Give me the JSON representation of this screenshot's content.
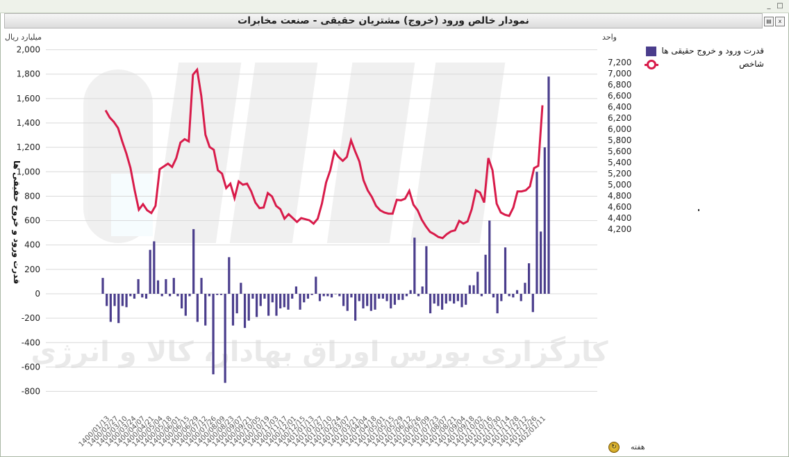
{
  "window": {
    "title": "نمودار خالص ورود (خروج) مشتریان حقیقی - صنعت مخابرات",
    "minimize_glyph": "_",
    "maximize_glyph": "□"
  },
  "toolbar": {
    "print_icon": "printer-icon",
    "export_icon": "excel-icon"
  },
  "footer": {
    "x_axis_unit": "هفته",
    "refresh_icon": "refresh-icon"
  },
  "watermark": "کارگزاری بورس اوراق بهادار، کالا و انرژی",
  "colors": {
    "bars": "#4a3d8c",
    "line": "#d81b4a",
    "grid": "#d9d9d9"
  },
  "chart_data": {
    "type": "bar+line",
    "left_axis_unit": "میلیارد ریال",
    "left_axis_title": "قدرت ورود و خروج حقیقی ها",
    "right_axis_unit": "واحد",
    "left_ylim": [
      -900,
      2000
    ],
    "right_ylim": [
      4100,
      7300
    ],
    "left_ticks": [
      "2,000",
      "1,800",
      "1,600",
      "1,400",
      "1,200",
      "1,000",
      "800",
      "600",
      "400",
      "200",
      "0",
      "-200",
      "-400",
      "-600",
      "-800"
    ],
    "left_tick_values": [
      2000,
      1800,
      1600,
      1400,
      1200,
      1000,
      800,
      600,
      400,
      200,
      0,
      -200,
      -400,
      -600,
      -800
    ],
    "right_ticks": [
      "7,200",
      "7,000",
      "6,800",
      "6,600",
      "6,400",
      "6,200",
      "6,000",
      "5,800",
      "5,600",
      "5,400",
      "5,200",
      "5,000",
      "4,800",
      "4,600",
      "4,400",
      "4,200"
    ],
    "right_tick_values": [
      7200,
      7000,
      6800,
      6600,
      6400,
      6200,
      6000,
      5800,
      5600,
      5400,
      5200,
      5000,
      4800,
      4600,
      4400,
      4200
    ],
    "x_tick_labels": [
      "1400/01/13",
      "1400/02/27",
      "1400/03/10",
      "1400/03/24",
      "1400/04/07",
      "1400/04/21",
      "1400/05/04",
      "1400/05/18",
      "1400/06/01",
      "1400/06/15",
      "1400/06/29",
      "1400/07/12",
      "1400/07/26",
      "1400/08/09",
      "1400/08/23",
      "1400/09/07",
      "1400/09/21",
      "1400/10/05",
      "1400/10/19",
      "1400/11/03",
      "1400/11/17",
      "1400/12/01",
      "1400/12/15",
      "1401/01/13",
      "1401/01/27",
      "1401/02/10",
      "1401/02/24",
      "1401/03/07",
      "1401/03/21",
      "1401/04/04",
      "1401/04/18",
      "1401/05/01",
      "1401/05/15",
      "1401/05/29",
      "1401/06/12",
      "1401/06/26",
      "1401/07/09",
      "1401/07/23",
      "1401/08/07",
      "1401/08/21",
      "1401/09/04",
      "1401/09/18",
      "1401/10/02",
      "1401/10/16",
      "1401/10/30",
      "1401/11/14",
      "1401/11/28",
      "1401/12/12",
      "1401/12/26",
      "1402/01/11"
    ],
    "series": [
      {
        "name": "قدرت ورود و خروج حقیقی ها",
        "type": "bar",
        "axis": "left",
        "values": [
          130,
          -100,
          -230,
          -100,
          -240,
          -100,
          -110,
          -20,
          -40,
          120,
          -30,
          -40,
          360,
          430,
          110,
          -20,
          120,
          -20,
          130,
          -20,
          -120,
          -180,
          -20,
          530,
          -230,
          130,
          -260,
          -20,
          -660,
          -10,
          -10,
          -730,
          300,
          -260,
          -160,
          90,
          -280,
          -220,
          -40,
          -190,
          -100,
          -40,
          -180,
          -70,
          -180,
          -120,
          -110,
          -130,
          -40,
          60,
          -130,
          -70,
          -40,
          -10,
          140,
          -60,
          -20,
          -20,
          -30,
          0,
          -20,
          -100,
          -140,
          -30,
          -220,
          -60,
          -120,
          -100,
          -140,
          -130,
          -40,
          -40,
          -60,
          -120,
          -90,
          -50,
          -50,
          -20,
          30,
          460,
          -20,
          60,
          390,
          -160,
          -80,
          -100,
          -130,
          -80,
          -60,
          -80,
          -60,
          -110,
          -90,
          70,
          70,
          180,
          -20,
          320,
          600,
          -30,
          -160,
          -60,
          380,
          -20,
          -30,
          30,
          -60,
          90,
          250,
          -150,
          1000,
          510,
          1200,
          1780
        ]
      },
      {
        "name": "شاخص",
        "type": "line",
        "axis": "right",
        "values": [
          6340,
          6210,
          6130,
          6020,
          5780,
          5560,
          5300,
          4900,
          4550,
          4650,
          4540,
          4490,
          4620,
          5280,
          5330,
          5380,
          5320,
          5480,
          5760,
          5820,
          5780,
          6980,
          7070,
          6600,
          5900,
          5680,
          5630,
          5260,
          5200,
          4940,
          5020,
          4760,
          5060,
          5000,
          5020,
          4880,
          4680,
          4580,
          4590,
          4850,
          4790,
          4620,
          4560,
          4390,
          4470,
          4400,
          4330,
          4400,
          4380,
          4360,
          4300,
          4390,
          4660,
          5040,
          5260,
          5600,
          5500,
          5430,
          5500,
          5800,
          5600,
          5420,
          5080,
          4900,
          4780,
          4620,
          4540,
          4500,
          4480,
          4480,
          4730,
          4720,
          4750,
          4890,
          4640,
          4540,
          4370,
          4250,
          4150,
          4110,
          4060,
          4040,
          4110,
          4160,
          4180,
          4350,
          4300,
          4340,
          4560,
          4900,
          4860,
          4680,
          5480,
          5260,
          4660,
          4500,
          4460,
          4440,
          4590,
          4880,
          4880,
          4900,
          4970,
          5300,
          5340,
          6430
        ]
      }
    ]
  }
}
